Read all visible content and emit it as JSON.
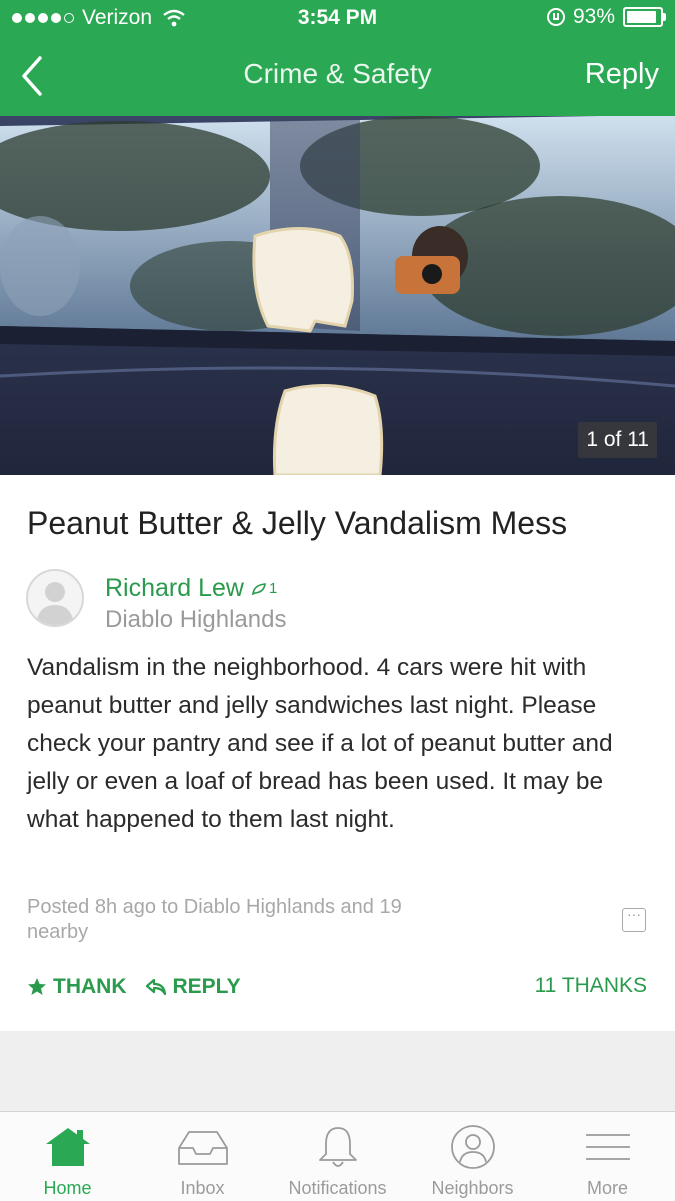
{
  "status_bar": {
    "carrier": "Verizon",
    "time": "3:54 PM",
    "battery": "93%"
  },
  "header": {
    "title": "Crime & Safety",
    "reply_label": "Reply"
  },
  "photo": {
    "counter": "1 of 11"
  },
  "post": {
    "title": "Peanut Butter & Jelly Vandalism Mess",
    "author": "Richard Lew",
    "author_badge_count": "1",
    "neighborhood": "Diablo Highlands",
    "body": "Vandalism in the neighborhood. 4 cars were hit with peanut butter and jelly sandwiches last night. Please check your pantry and see if a lot of peanut butter and jelly or even a loaf of bread has been used. It may be what happened to them last night.",
    "meta": "Posted 8h ago to Diablo Highlands and 19 nearby",
    "thank_label": "THANK",
    "reply_label": "REPLY",
    "thanks_count": "11 THANKS"
  },
  "tabs": [
    {
      "label": "Home",
      "icon": "home-icon",
      "active": true
    },
    {
      "label": "Inbox",
      "icon": "inbox-icon",
      "active": false
    },
    {
      "label": "Notifications",
      "icon": "bell-icon",
      "active": false
    },
    {
      "label": "Neighbors",
      "icon": "person-icon",
      "active": false
    },
    {
      "label": "More",
      "icon": "menu-icon",
      "active": false
    }
  ],
  "colors": {
    "brand_green": "#2aa853",
    "link_green": "#2a9a4c",
    "muted_text": "#9a9a9a"
  }
}
